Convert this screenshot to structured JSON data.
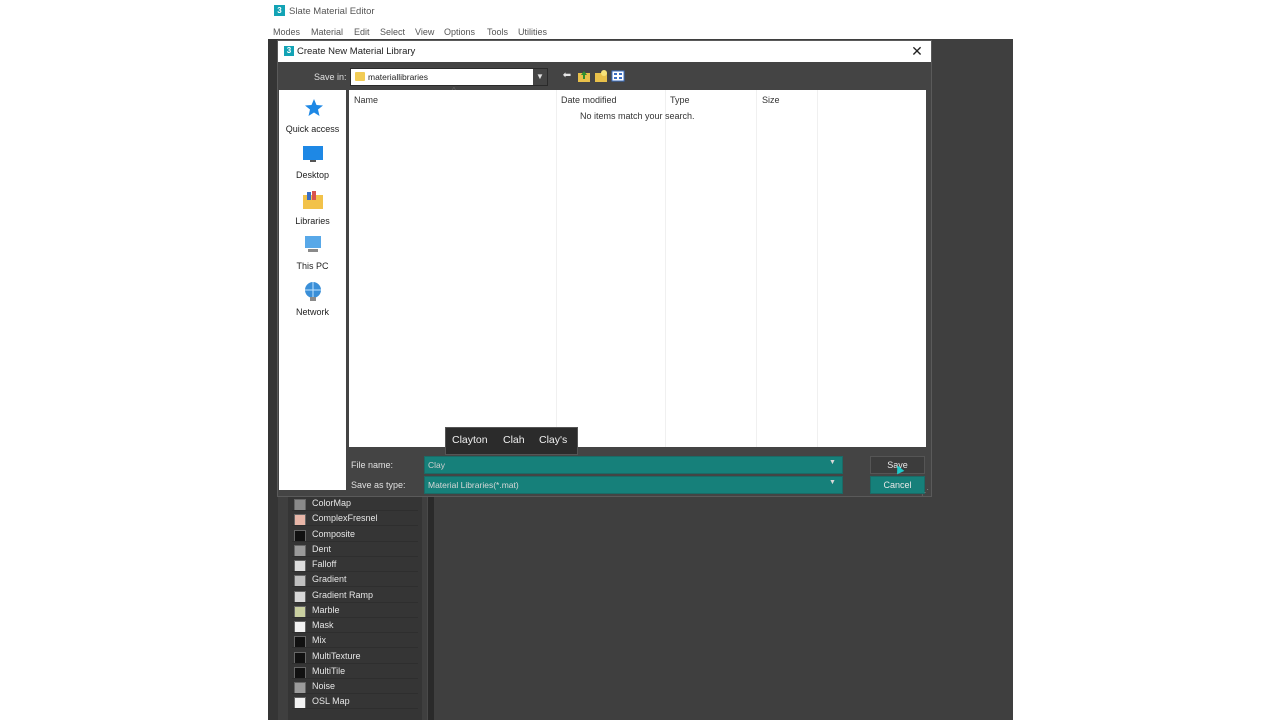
{
  "app": {
    "logo": "3",
    "title": "Slate Material Editor",
    "menu": [
      "Modes",
      "Material",
      "Edit",
      "Select",
      "View",
      "Options",
      "Tools",
      "Utilities"
    ]
  },
  "material_list": [
    {
      "label": "ColorMap",
      "swatch": "#8a8a8a"
    },
    {
      "label": "ComplexFresnel",
      "swatch": "#e8b6a8"
    },
    {
      "label": "Composite",
      "swatch": "#111111"
    },
    {
      "label": "Dent",
      "swatch": "#9a9a9a"
    },
    {
      "label": "Falloff",
      "swatch": "#dcdcdc"
    },
    {
      "label": "Gradient",
      "swatch": "#bfbfbf"
    },
    {
      "label": "Gradient Ramp",
      "swatch": "#d8d8d8"
    },
    {
      "label": "Marble",
      "swatch": "#c9cfa0"
    },
    {
      "label": "Mask",
      "swatch": "#f2f2f2"
    },
    {
      "label": "Mix",
      "swatch": "#111111"
    },
    {
      "label": "MultiTexture",
      "swatch": "#111111"
    },
    {
      "label": "MultiTile",
      "swatch": "#111111"
    },
    {
      "label": "Noise",
      "swatch": "#9c9c9c"
    },
    {
      "label": "OSL Map",
      "swatch": "#f2f2f2"
    }
  ],
  "dialog": {
    "logo": "3",
    "title": "Create New Material Library",
    "close_symbol": "✕",
    "save_in_label": "Save in:",
    "save_in_value": "materiallibraries",
    "places": [
      {
        "label": "Quick access",
        "icon": "star-icon"
      },
      {
        "label": "Desktop",
        "icon": "desktop-icon"
      },
      {
        "label": "Libraries",
        "icon": "libraries-icon"
      },
      {
        "label": "This PC",
        "icon": "computer-icon"
      },
      {
        "label": "Network",
        "icon": "network-icon"
      }
    ],
    "columns": [
      "Name",
      "Date modified",
      "Type",
      "Size"
    ],
    "empty_message": "No items match your search.",
    "autocomplete": [
      "Clayton",
      "Clah",
      "Clay's"
    ],
    "file_name_label": "File name:",
    "file_name_value": "Clay",
    "save_as_type_label": "Save as type:",
    "save_as_type_value": "Material Libraries(*.mat)",
    "save_button": "Save",
    "cancel_button": "Cancel"
  },
  "colors": {
    "accent": "#16807a",
    "app_bg": "#444444"
  }
}
